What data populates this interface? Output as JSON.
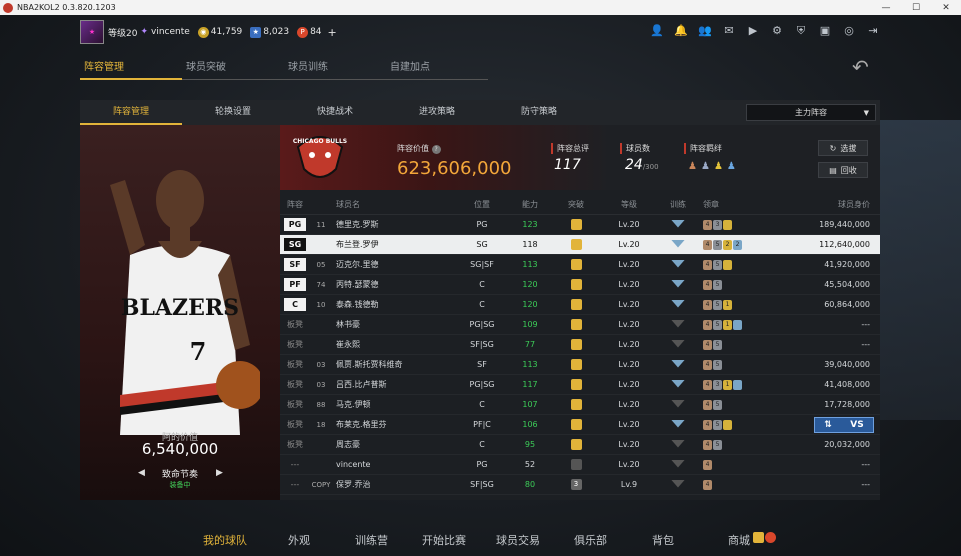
{
  "window": {
    "title": "NBA2KOL2 0.3.820.1203",
    "min": "—",
    "max": "☐",
    "close": "✕"
  },
  "user": {
    "level": "等级20",
    "name": "vincente",
    "currency1": "41,759",
    "currency2": "8,023",
    "currency3": "84",
    "plus": "+"
  },
  "nav_tabs": [
    "阵容管理",
    "球员突破",
    "球员训练",
    "自建加点"
  ],
  "sub_tabs": [
    "阵容管理",
    "轮换设置",
    "快捷战术",
    "进攻策略",
    "防守策略"
  ],
  "lineup_dropdown": "主力阵容",
  "featured_player": {
    "value_label": "阿的价值",
    "value": "6,540,000",
    "name": "致命节奏",
    "role": "装备中",
    "jersey_team": "BLAZERS",
    "jersey_number": "7"
  },
  "summary": {
    "team_logo_text": "CHICAGO BULLS",
    "value_label": "阵容价值",
    "value": "623,606,000",
    "rating_label": "阵容总评",
    "rating": "117",
    "count_label": "球员数",
    "count": "24",
    "count_max": "/300",
    "bond_label": "阵容羁绊",
    "btn_select": "选拔",
    "btn_recycle": "回收"
  },
  "table": {
    "headers": [
      "阵容",
      "球员名",
      "位置",
      "能力",
      "突破",
      "等级",
      "训练",
      "领章",
      "球员身价"
    ],
    "rows": [
      {
        "slot": "PG",
        "num": "11",
        "name": "德里克.罗斯",
        "pos": "PG",
        "ability": "123",
        "level": "Lv.20",
        "value": "189,440,000",
        "starter": true,
        "green": true,
        "leaders": [
          "4",
          "3",
          ""
        ]
      },
      {
        "slot": "SG",
        "num": "",
        "name": "布兰登.罗伊",
        "pos": "SG",
        "ability": "118",
        "level": "Lv.20",
        "value": "112,640,000",
        "starter": true,
        "green": false,
        "selected": true,
        "leaders": [
          "4",
          "5",
          "2",
          "2"
        ]
      },
      {
        "slot": "SF",
        "num": "05",
        "name": "迈克尔.里德",
        "pos": "SG|SF",
        "ability": "113",
        "level": "Lv.20",
        "value": "41,920,000",
        "starter": true,
        "green": true,
        "leaders": [
          "4",
          "5",
          ""
        ]
      },
      {
        "slot": "PF",
        "num": "74",
        "name": "丙特.瑟蒙德",
        "pos": "C",
        "ability": "120",
        "level": "Lv.20",
        "value": "45,504,000",
        "starter": true,
        "green": true,
        "leaders": [
          "4",
          "5"
        ]
      },
      {
        "slot": "C",
        "num": "10",
        "name": "泰森.钱德勒",
        "pos": "C",
        "ability": "120",
        "level": "Lv.20",
        "value": "60,864,000",
        "starter": true,
        "green": true,
        "leaders": [
          "4",
          "5",
          "1"
        ]
      },
      {
        "slot": "板凳",
        "num": "",
        "name": "林书豪",
        "pos": "PG|SG",
        "ability": "109",
        "level": "Lv.20",
        "value": "---",
        "starter": false,
        "green": true,
        "leaders": [
          "4",
          "5",
          "1",
          ""
        ]
      },
      {
        "slot": "板凳",
        "num": "",
        "name": "崔永熙",
        "pos": "SF|SG",
        "ability": "77",
        "level": "Lv.20",
        "value": "---",
        "starter": false,
        "green": true,
        "leaders": [
          "4",
          "5"
        ]
      },
      {
        "slot": "板凳",
        "num": "03",
        "name": "佩贾.斯托贾科维奇",
        "pos": "SF",
        "ability": "113",
        "level": "Lv.20",
        "value": "39,040,000",
        "starter": false,
        "green": true,
        "leaders": [
          "4",
          "5"
        ]
      },
      {
        "slot": "板凳",
        "num": "03",
        "name": "吕西.比卢普斯",
        "pos": "PG|SG",
        "ability": "117",
        "level": "Lv.20",
        "value": "41,408,000",
        "starter": false,
        "green": true,
        "leaders": [
          "4",
          "3",
          "1",
          ""
        ]
      },
      {
        "slot": "板凳",
        "num": "88",
        "name": "马克.伊顿",
        "pos": "C",
        "ability": "107",
        "level": "Lv.20",
        "value": "17,728,000",
        "starter": false,
        "green": true,
        "leaders": [
          "4",
          "5"
        ]
      },
      {
        "slot": "板凳",
        "num": "18",
        "name": "布莱克.格里芬",
        "pos": "PF|C",
        "ability": "106",
        "level": "Lv.20",
        "value": "",
        "starter": false,
        "green": true,
        "leaders": [
          "4",
          "5",
          ""
        ],
        "vs": true
      },
      {
        "slot": "板凳",
        "num": "",
        "name": "周志豪",
        "pos": "C",
        "ability": "95",
        "level": "Lv.20",
        "value": "20,032,000",
        "starter": false,
        "green": true,
        "leaders": [
          "4",
          "5"
        ]
      },
      {
        "slot": "---",
        "num": "",
        "name": "vincente",
        "pos": "PG",
        "ability": "52",
        "level": "Lv.20",
        "value": "---",
        "starter": false,
        "green": false,
        "leaders": [
          "4"
        ]
      },
      {
        "slot": "---",
        "num": "COPY",
        "name": "保罗.乔治",
        "pos": "SF|SG",
        "ability": "80",
        "level": "Lv.9",
        "value": "---",
        "starter": false,
        "green": true,
        "leaders": [
          "4"
        ],
        "breakthrough": "3"
      }
    ]
  },
  "vs_button": {
    "swap": "⇅",
    "label": "VS"
  },
  "bottom_nav": [
    "我的球队",
    "外观",
    "训练营",
    "开始比赛",
    "球员交易",
    "俱乐部",
    "背包",
    "商城"
  ]
}
